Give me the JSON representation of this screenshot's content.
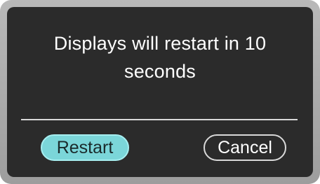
{
  "dialog": {
    "message_line1": "Displays will restart in 10",
    "message_line2": "seconds",
    "restart_label": "Restart",
    "cancel_label": "Cancel"
  },
  "colors": {
    "frame": "#a9a9a9",
    "dialog_background": "#2b2b2b",
    "text": "#ffffff",
    "divider": "#d9d9d9",
    "restart_button_selected": "#7bd6d9"
  }
}
